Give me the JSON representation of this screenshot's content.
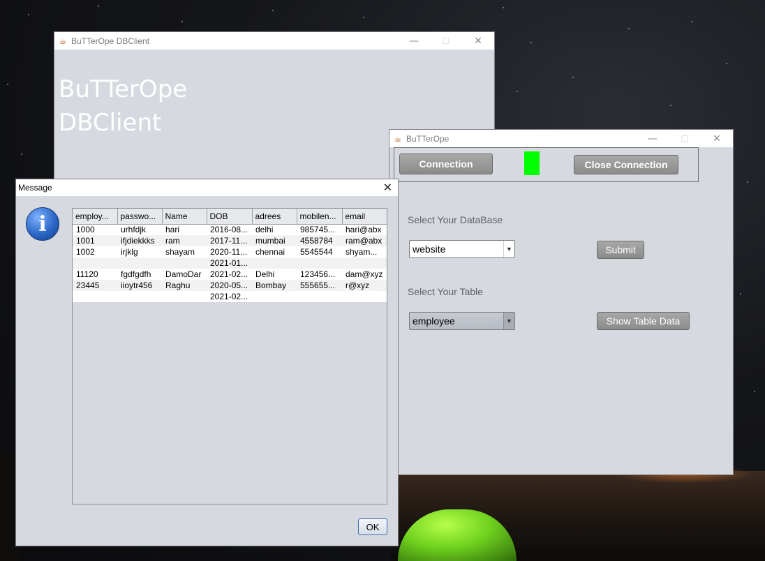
{
  "colors": {
    "indicator": "#00ff00",
    "window_bg": "#d6d9df",
    "button_gray": "#8b8b8b"
  },
  "win1": {
    "title": "BuTTerOpe DBClient",
    "heading_line1": "BuTTerOpe",
    "heading_line2": "DBClient",
    "icon": "java-icon"
  },
  "win2": {
    "title": "BuTTerOpe",
    "icon": "java-icon",
    "connection_label": "Connection",
    "close_connection_label": "Close Connection",
    "db_label": "Select Your DataBase",
    "db_value": "website",
    "submit_label": "Submit",
    "table_label": "Select Your Table",
    "table_value": "employee",
    "show_table_label": "Show Table Data"
  },
  "message": {
    "title": "Message",
    "icon": "info-icon",
    "ok_label": "OK",
    "columns": [
      "employ...",
      "passwo...",
      "Name",
      "DOB",
      "adrees",
      "mobilen...",
      "email"
    ],
    "rows": [
      [
        "1000",
        "urhfdjk",
        "hari",
        "2016-08...",
        "delhi",
        "985745...",
        "hari@abx"
      ],
      [
        "1001",
        "ifjdiekkks",
        "ram",
        "2017-11...",
        "mumbai",
        "4558784",
        "ram@abx"
      ],
      [
        "1002",
        "irjklg",
        "shayam",
        "2020-11...",
        "chennai",
        "5545544",
        "shyam..."
      ],
      [
        "",
        "",
        "",
        "2021-01...",
        "",
        "",
        ""
      ],
      [
        "11120",
        "fgdfgdfh",
        "DamoDar",
        "2021-02...",
        "Delhi",
        "123456...",
        "dam@xyz"
      ],
      [
        "23445",
        "iioytr456",
        "Raghu",
        "2020-05...",
        "Bombay",
        "555655...",
        "r@xyz"
      ],
      [
        "",
        "",
        "",
        "2021-02...",
        "",
        "",
        ""
      ]
    ]
  }
}
